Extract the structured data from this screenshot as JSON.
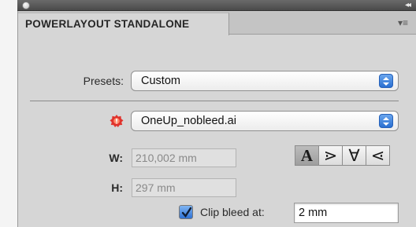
{
  "panel": {
    "tab_title": "POWERLAYOUT STANDALONE",
    "close_icon": "close-dot-icon",
    "collapse_icon": "double-chevron-left-icon",
    "menu_icon": "panel-menu-icon"
  },
  "presets": {
    "label": "Presets:",
    "value": "Custom"
  },
  "document": {
    "warning_icon": "red-warning-icon",
    "file_value": "OneUp_nobleed.ai"
  },
  "size": {
    "width_label": "W:",
    "width_value": "210,002 mm",
    "height_label": "H:",
    "height_value": "297 mm"
  },
  "alignment": {
    "buttons": [
      {
        "glyph": "A",
        "name": "align-top",
        "active": true
      },
      {
        "glyph": "⋗",
        "name": "align-left",
        "active": false
      },
      {
        "glyph": "∀",
        "name": "align-bottom",
        "active": false
      },
      {
        "glyph": "⋖",
        "name": "align-right",
        "active": false
      }
    ]
  },
  "bleed": {
    "checkbox_label": "Clip bleed at:",
    "checked": true,
    "value": "2 mm"
  },
  "colors": {
    "panel_bg": "#d6d6d6",
    "accent_blue": "#2a6fd1",
    "warning_red": "#e0332d"
  }
}
